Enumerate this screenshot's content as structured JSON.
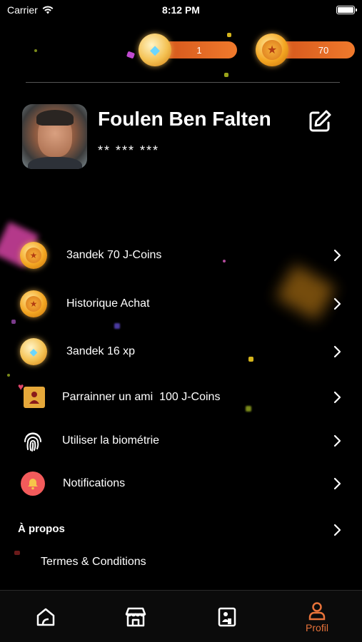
{
  "status_bar": {
    "carrier": "Carrier",
    "time": "8:12 PM"
  },
  "currencies": {
    "diamonds": "1",
    "coins": "70"
  },
  "profile": {
    "name": "Foulen Ben Falten",
    "phone": "** *** ***"
  },
  "menu": [
    {
      "label": "3andek 70 J-Coins",
      "icon": "gold-coin-icon"
    },
    {
      "label": "Historique Achat",
      "icon": "gold-coin-icon"
    },
    {
      "label": "3andek 16 xp",
      "icon": "diamond-coin-icon"
    },
    {
      "label": "Parrainner un ami  100 J-Coins",
      "icon": "referral-icon"
    },
    {
      "label": "Utiliser la biométrie",
      "icon": "fingerprint-icon"
    },
    {
      "label": "Notifications",
      "icon": "bell-icon"
    }
  ],
  "about": {
    "title": "À propos",
    "terms": "Termes & Conditions"
  },
  "tabbar": {
    "active_label": "Profil"
  },
  "colors": {
    "accent": "#e8733a",
    "background": "#000000",
    "pill": "#f07a2c",
    "bell": "#f35b5b"
  }
}
